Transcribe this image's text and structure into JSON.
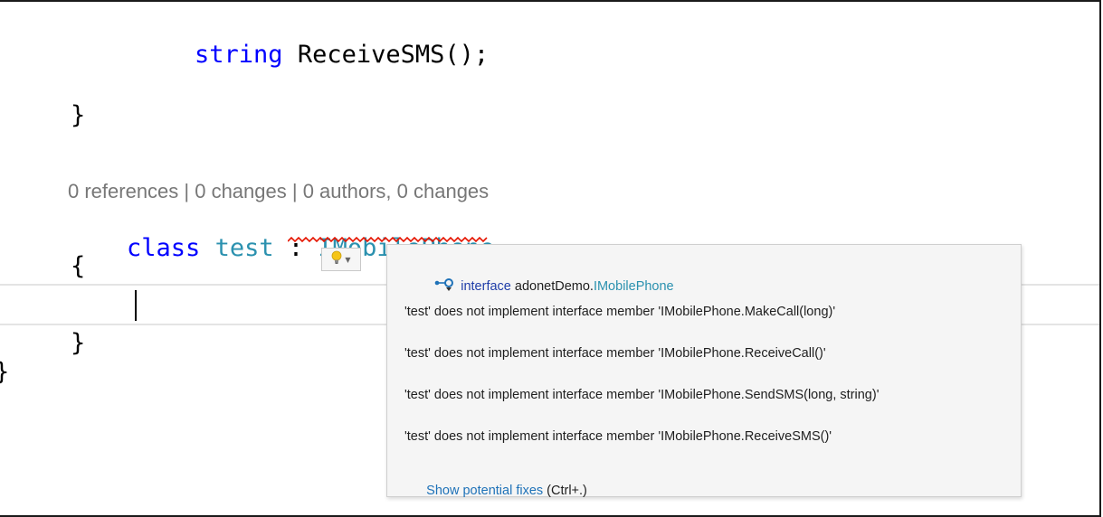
{
  "code": {
    "line1": {
      "type": "string",
      "method": "ReceiveSMS",
      "rest": "();"
    },
    "close_brace_1": "}",
    "codelens": "0 references | 0 changes | 0 authors, 0 changes",
    "class_line": {
      "keyword": "class",
      "name": "test",
      "sep": " : ",
      "interface": "IMobilePhone"
    },
    "open_brace": "{",
    "close_brace_2": "}",
    "outer_brace": "}"
  },
  "tooltip": {
    "header": {
      "keyword": "interface",
      "namespace": "adonetDemo.",
      "type": "IMobilePhone"
    },
    "errors": [
      "'test' does not implement interface member 'IMobilePhone.MakeCall(long)'",
      "'test' does not implement interface member 'IMobilePhone.ReceiveCall()'",
      "'test' does not implement interface member 'IMobilePhone.SendSMS(long, string)'",
      "'test' does not implement interface member 'IMobilePhone.ReceiveSMS()'"
    ],
    "fix_link": "Show potential fixes",
    "fix_shortcut": " (Ctrl+.)"
  },
  "icons": {
    "lightbulb": "lightbulb-icon",
    "dropdown": "chevron-down-icon",
    "interface": "interface-icon"
  },
  "colors": {
    "keyword": "#0000ff",
    "type": "#2b91af",
    "error_squiggle": "#e51400",
    "link": "#1f72b8"
  }
}
